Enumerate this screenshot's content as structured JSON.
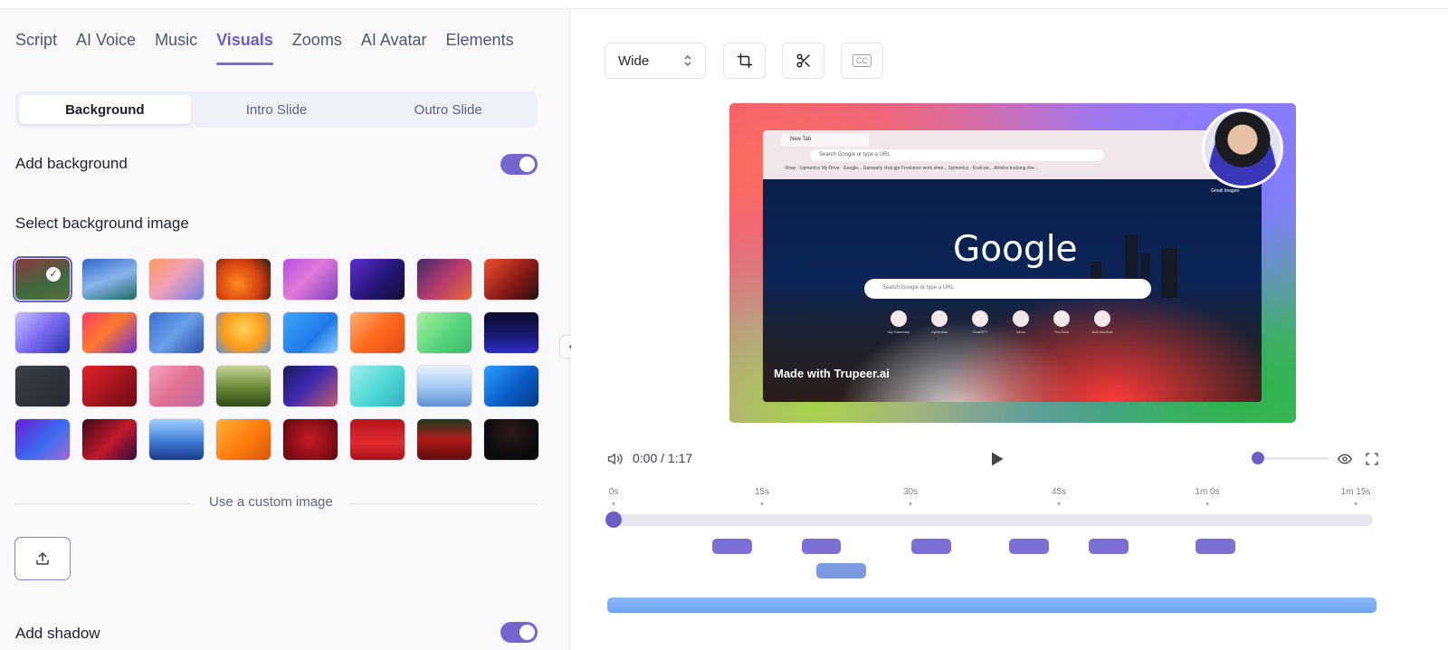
{
  "tabs": [
    {
      "label": "Script"
    },
    {
      "label": "AI Voice"
    },
    {
      "label": "Music"
    },
    {
      "label": "Visuals"
    },
    {
      "label": "Zooms"
    },
    {
      "label": "AI Avatar"
    },
    {
      "label": "Elements"
    }
  ],
  "active_tab": "Visuals",
  "segments": [
    {
      "label": "Background"
    },
    {
      "label": "Intro Slide"
    },
    {
      "label": "Outro Slide"
    }
  ],
  "add_background": {
    "label": "Add background",
    "enabled": true
  },
  "select_bg_label": "Select background image",
  "backgrounds": [
    {
      "gradient": "linear-gradient(160deg,#8a3b42 0%,#3e6a3e 60%,#5a6f3b 100%)",
      "selected": true
    },
    {
      "gradient": "linear-gradient(160deg,#2f66c7 0%,#89b4ee 50%,#1f6b5f 100%)"
    },
    {
      "gradient": "linear-gradient(135deg,#ff9a5a 0%,#f2a1b9 45%,#6e82e4 100%)"
    },
    {
      "gradient": "radial-gradient(circle at 40% 60%,#ff8a1c 0%,#d43f0f 55%,#2b1a1a 100%)"
    },
    {
      "gradient": "linear-gradient(135deg,#b94de0 0%,#e07ad8 45%,#7c3fbf 100%)"
    },
    {
      "gradient": "linear-gradient(135deg,#5b2fd1 0%,#2a1780 50%,#0f0f2a 100%)"
    },
    {
      "gradient": "linear-gradient(135deg,#3b2b6a 0%,#b43c6c 50%,#e56a36 100%)"
    },
    {
      "gradient": "linear-gradient(135deg,#f0502b 0%,#8b1b18 55%,#241010 100%)"
    },
    {
      "gradient": "linear-gradient(135deg,#c7c0ff 0%,#7a6bf0 50%,#2b2fa8 100%)"
    },
    {
      "gradient": "linear-gradient(135deg,#ff3b6a 0%,#ff7a2a 45%,#6a2fd6 100%)"
    },
    {
      "gradient": "linear-gradient(135deg,#3b6fd1 0%,#6a9ee8 50%,#2a4fa8 100%)"
    },
    {
      "gradient": "radial-gradient(circle at 50% 40%,#ffd35a 0%,#ff9b1a 55%,#4b93e0 100%)"
    },
    {
      "gradient": "linear-gradient(135deg,#3ea8ff 0%,#1f7ae6 60%,#8fd0ff 100%)"
    },
    {
      "gradient": "linear-gradient(135deg,#ffb071 0%,#ff6a1f 50%,#e04a12 100%)"
    },
    {
      "gradient": "linear-gradient(135deg,#a8f0a0 0%,#56d47a 55%,#3bb86a 100%)"
    },
    {
      "gradient": "linear-gradient(180deg,#0b0b2a 0%,#1a1a7a 60%,#2e2ec7 100%)"
    },
    {
      "gradient": "linear-gradient(135deg,#3a3f47 0%,#262b32 100%)"
    },
    {
      "gradient": "linear-gradient(135deg,#e2202a 0%,#a0141c 55%,#6b0d12 100%)"
    },
    {
      "gradient": "linear-gradient(135deg,#f4a3c0 0%,#e0708f 50%,#c06ba8 100%)"
    },
    {
      "gradient": "linear-gradient(180deg,#c7d39a 0%,#6f8f3a 50%,#2f4a1a 100%)"
    },
    {
      "gradient": "linear-gradient(135deg,#1b1a55 0%,#3a2ab0 45%,#c45c6c 100%)"
    },
    {
      "gradient": "linear-gradient(135deg,#9ff0ee 0%,#4dd6d4 55%,#2fb1c2 100%)"
    },
    {
      "gradient": "linear-gradient(180deg,#e9f3ff 0%,#9fc6f0 55%,#5f8fd4 100%)"
    },
    {
      "gradient": "linear-gradient(135deg,#2aa0ff 0%,#0b5cc7 55%,#073a86 100%)"
    },
    {
      "gradient": "linear-gradient(135deg,#6a1bd6 0%,#3a6cf0 55%,#a06ad8 100%)"
    },
    {
      "gradient": "linear-gradient(135deg,#3b0b1a 0%,#c21a2a 55%,#2a0b3a 100%)"
    },
    {
      "gradient": "linear-gradient(180deg,#9fd0ff 0%,#3f7bd6 55%,#1a3a8a 100%)"
    },
    {
      "gradient": "linear-gradient(135deg,#ffb23a 0%,#ff7a0b 55%,#d6580b 100%)"
    },
    {
      "gradient": "radial-gradient(circle at 50% 50%,#c41a25 0%,#8a0f16 60%,#5a0a0f 100%)"
    },
    {
      "gradient": "linear-gradient(180deg,#b9141c 0%,#e02a2f 60%,#a8101a 100%)"
    },
    {
      "gradient": "linear-gradient(180deg,#1e3a1e 0%,#b01a1a 50%,#5e0b0b 100%)"
    },
    {
      "gradient": "radial-gradient(circle at 50% 30%,#2e1a1a 0%,#0b0b0b 70%)"
    }
  ],
  "custom_image_label": "Use a custom image",
  "add_shadow": {
    "label": "Add shadow",
    "enabled": true
  },
  "toolbar": {
    "aspect_label": "Wide",
    "crop_icon": "crop-icon",
    "cut_icon": "scissors-icon",
    "cc_label": "CC"
  },
  "preview": {
    "tab_title": "New Tab",
    "omnibox": "Search Google or type a URL",
    "bookmarks": "Vinay · Upmetrics   My Drive · Google...   Gamearly   chat gpt   Freelance work shee...   Upmetrics · Kruti wo...   Articles tracking she...",
    "header_links": "Gmail  Images",
    "logo_text": "Google",
    "search_placeholder": "Search Google or type a URL",
    "shortcuts": [
      "My Gamearly",
      "Upmetrics",
      "ChatGPT",
      "Inbox",
      "YouTube",
      "Add shortcut"
    ],
    "watermark": "Made with Trupeer.ai"
  },
  "player": {
    "time": "0:00 / 1:17",
    "volume_fraction": 0.05
  },
  "timeline": {
    "ticks": [
      "0s",
      "15s",
      "30s",
      "45s",
      "1m 0s",
      "1m 15s"
    ],
    "tick_seconds": [
      0,
      15,
      30,
      45,
      60,
      75
    ],
    "duration_seconds": 77,
    "playhead_seconds": 0,
    "clips_row1": [
      {
        "start": 10.0,
        "end": 14.0
      },
      {
        "start": 19.0,
        "end": 23.0
      },
      {
        "start": 30.1,
        "end": 34.1
      },
      {
        "start": 40.0,
        "end": 44.0
      },
      {
        "start": 48.0,
        "end": 52.0
      },
      {
        "start": 58.8,
        "end": 62.8
      }
    ],
    "clips_row2": [
      {
        "start": 20.5,
        "end": 25.5
      }
    ],
    "accent": "#6b5fc7",
    "bar_color": "#6ea3f1"
  }
}
